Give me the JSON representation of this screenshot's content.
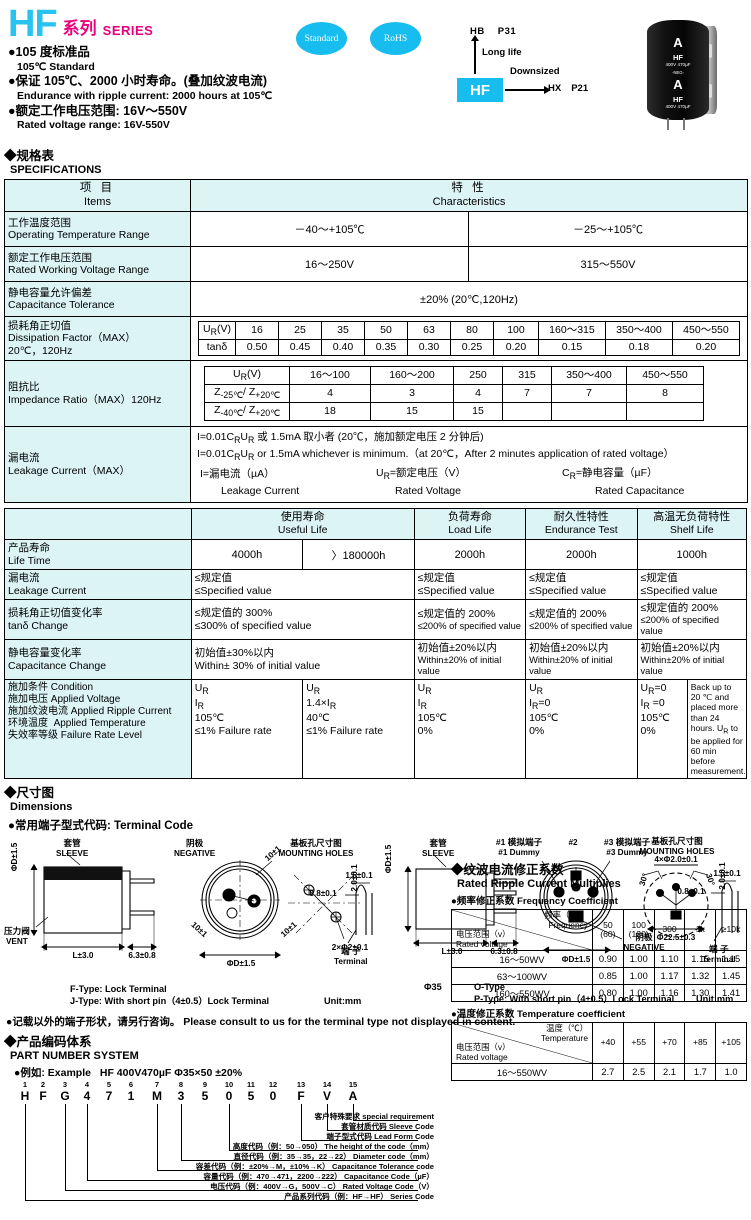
{
  "header": {
    "series_code": "HF",
    "series_cn": "系列",
    "series_en": "SERIES",
    "bullets": [
      {
        "cn": "●105 度标准品",
        "en": "105℃ Standard"
      },
      {
        "cn": "●保证 105℃、2000 小时寿命。(叠加纹波电流)",
        "en": "Endurance with ripple current: 2000 hours at 105℃"
      },
      {
        "cn": "●额定工作电压范围: 16V～550V",
        "en": "Rated voltage range: 16V-550V"
      }
    ],
    "badges": [
      "Standard",
      "RoHS"
    ],
    "roadmap": {
      "top_code": "HB",
      "top_page": "P31",
      "up_label": "Long life",
      "down_label": "Downsized",
      "center": "HF",
      "right_code": "HX",
      "right_page": "P21"
    },
    "photo": {
      "logo": "A",
      "name": "HF",
      "rating": "400V 470µF",
      "polarity": "-NEG-"
    }
  },
  "spec_section": {
    "title_cn": "◆规格表",
    "title_en": "SPECIFICATIONS",
    "head_item_cn": "项 目",
    "head_item_en": "Items",
    "head_char_cn": "特 性",
    "head_char_en": "Characteristics",
    "rows": {
      "temp": {
        "cn": "工作温度范围",
        "en": "Operating Temperature Range",
        "v1": "－40～+105℃",
        "v2": "－25～+105℃"
      },
      "voltage": {
        "cn": "额定工作电压范围",
        "en": "Rated Working Voltage Range",
        "v1": "16～250V",
        "v2": "315～550V"
      },
      "tolerance": {
        "cn": "静电容量允许偏差",
        "en": "Capacitance Tolerance",
        "value": "±20%   (20℃,120Hz)"
      },
      "dissipation": {
        "cn": "损耗角正切值",
        "en": "Dissipation Factor（MAX）",
        "cond": "20℃，120Hz",
        "row1_key": "UR(V)",
        "row2_key": "tanδ",
        "ur": [
          "16",
          "25",
          "35",
          "50",
          "63",
          "80",
          "100",
          "160～315",
          "350～400",
          "450～550"
        ],
        "tand": [
          "0.50",
          "0.45",
          "0.40",
          "0.35",
          "0.30",
          "0.25",
          "0.20",
          "0.15",
          "0.18",
          "0.20"
        ]
      },
      "impedance": {
        "cn": "阻抗比",
        "en": "Impedance Ratio（MAX）120Hz",
        "row1_key": "UR(V)",
        "row2_key": "Z-25℃/ Z+20℃",
        "row3_key": "Z-40℃/ Z+20℃",
        "ur": [
          "16～100",
          "160～200",
          "250",
          "315",
          "350～400",
          "450～550"
        ],
        "z25": [
          "4",
          "3",
          "4",
          "7",
          "7",
          "8"
        ],
        "z40": [
          "18",
          "15",
          "15",
          "",
          "",
          ""
        ]
      },
      "leakage": {
        "cn": "漏电流",
        "en": "Leakage Current（MAX）",
        "line1": "I=0.01CRUR 或 1.5mA 取小者  (20℃，施加额定电压 2 分钟后)",
        "line2": "I=0.01CRUR or 1.5mA whichever is minimum.（at 20℃，After 2 minutes application of rated voltage）",
        "line3_a": "I=漏电流（µA）",
        "line3_b": "UR=额定电压（V）",
        "line3_c": "CR=静电容量（µF）",
        "line4_a": "Leakage Current",
        "line4_b": "Rated Voltage",
        "line4_c": "Rated Capacitance"
      }
    }
  },
  "life_table": {
    "columns": [
      {
        "cn": "使用寿命",
        "en": "Useful Life"
      },
      {
        "cn": "负荷寿命",
        "en": "Load Life"
      },
      {
        "cn": "耐久性特性",
        "en": "Endurance Test"
      },
      {
        "cn": "高温无负荷特性",
        "en": "Shelf Life"
      }
    ],
    "life_time": {
      "cn": "产品寿命",
      "en": "Life Time",
      "values": [
        "4000h",
        "〉180000h",
        "2000h",
        "2000h",
        "1000h"
      ]
    },
    "leakage": {
      "cn": "漏电流",
      "en": "Leakage Current",
      "values": [
        {
          "cn": "≤规定值",
          "en": "≤Specified value"
        },
        {
          "cn": "≤规定值",
          "en": "≤Specified value"
        },
        {
          "cn": "≤规定值",
          "en": "≤Specified value"
        },
        {
          "cn": "≤规定值",
          "en": "≤Specified value"
        }
      ]
    },
    "tand": {
      "cn": "损耗角正切值变化率",
      "en": "tanδ Change",
      "values": [
        {
          "cn": "≤规定值的 300%",
          "en": "≤300% of specified value"
        },
        {
          "cn": "≤规定值的 200%",
          "en": "≤200% of specified value"
        },
        {
          "cn": "≤规定值的 200%",
          "en": "≤200% of specified value"
        },
        {
          "cn": "≤规定值的 200%",
          "en": "≤200% of specified value"
        }
      ]
    },
    "capchange": {
      "cn": "静电容量变化率",
      "en": "Capacitance Change",
      "values": [
        {
          "cn": "初始值±30%以内",
          "en": "Within± 30% of initial value"
        },
        {
          "cn": "初始值±20%以内",
          "en": "Within±20% of initial value"
        },
        {
          "cn": "初始值±20%以内",
          "en": "Within±20% of initial value"
        },
        {
          "cn": "初始值±20%以内",
          "en": "Within±20% of initial value"
        }
      ]
    },
    "condition": {
      "labels": [
        {
          "cn": "施加条件",
          "en": "Condition"
        },
        {
          "cn": "施加电压",
          "en": "Applied Voltage"
        },
        {
          "cn": "施加纹波电流",
          "en": "Applied Ripple Current"
        },
        {
          "cn": "环境温度",
          "en": "Applied Temperature"
        },
        {
          "cn": "失效率等级",
          "en": "Failure Rate Level"
        }
      ],
      "cols": [
        [
          "UR",
          "IR",
          "105℃",
          "≤1% Failure rate"
        ],
        [
          "UR",
          "1.4×IR",
          "40℃",
          "≤1% Failure rate"
        ],
        [
          "UR",
          "IR",
          "105℃",
          "0%"
        ],
        [
          "UR",
          "IR=0",
          "105℃",
          "0%"
        ],
        [
          "UR=0",
          "IR =0",
          "105℃",
          "0%"
        ]
      ],
      "backup": "Back up to 20 ℃ and placed more than 24 hours. UR to be applied for 60 min before measurement."
    }
  },
  "dimensions": {
    "title_cn": "◆尺寸图",
    "title_en": "Dimensions",
    "sub_cn": "●常用端子型式代码:",
    "sub_en": "Terminal Code",
    "left": {
      "sleeve_cn": "套管",
      "sleeve_en": "SLEEVE",
      "negative_cn": "阴极",
      "negative_en": "NEGATIVE",
      "mount_cn": "基板孔尺寸图",
      "mount_en": "MOUNTING HOLES",
      "vent_cn": "压力阀",
      "vent_en": "VENT",
      "d_label": "ΦD±1.5",
      "l_label": "L±3.0",
      "pin_label": "6.3±0.8",
      "d2_label": "ΦD±1.5",
      "pitch": "10±1",
      "pitch2": "10±1",
      "hole": "2×Φ2±0.1",
      "w15": "1.5±0.1",
      "w08": "0.8±0.1",
      "h20": "2.0±0.1",
      "terminal_cn": "端 子",
      "terminal_en": "Terminal",
      "note1": "F-Type:  Lock Terminal",
      "note2": "J-Type:  With short pin（4±0.5）Lock Terminal",
      "unit": "Unit:mm"
    },
    "right": {
      "sleeve_cn": "套管",
      "sleeve_en": "SLEEVE",
      "d1_cn": "#1 模拟端子",
      "d1_en": "#1 Dummy",
      "d2_top": "#2",
      "d3_cn": "#3 模拟端子",
      "d3_en": "#3 Dummy",
      "negative_cn": "阴极",
      "negative_en": "NEGATIVE",
      "mount_cn": "基板孔尺寸图",
      "mount_en": "MOUNTING HOLES",
      "d_label": "ΦD±1.5",
      "l_label": "L±3.0",
      "pin_label": "6.3±0.8",
      "d2_label": "ΦD±1.5",
      "holes": "4×Φ2.0±0.1",
      "circle": "Φ22.5±0.3",
      "ang1": "30°",
      "ang2": "30°",
      "w15": "1.5±0.1",
      "w08": "0.8±0.1",
      "h20": "2.0±0.1",
      "terminal_cn": "端 子",
      "terminal_en": "Terminal",
      "size": "Φ35",
      "note1": "O-Type",
      "note2": "P-Type:  With short pin（4±0.5）Lock Terminal",
      "unit": "Unit:mm"
    }
  },
  "part_number": {
    "consult_cn": "●记载以外的端子形状，请另行咨询。",
    "consult_en": "Please consult to us for the terminal type not displayed in content.",
    "title_cn": "◆产品编码体系",
    "title_en": "PART NUMBER SYSTEM",
    "example_cn": "●例如:",
    "example_en": "Example",
    "example_value": "HF 400V470µF Φ35×50 ±20%",
    "indices": [
      "1",
      "2",
      "3",
      "4",
      "5",
      "6",
      "7",
      "8",
      "9",
      "10",
      "11",
      "12",
      "13",
      "14",
      "15"
    ],
    "chars": [
      "H",
      "F",
      "G",
      "4",
      "7",
      "1",
      "M",
      "3",
      "5",
      "0",
      "5",
      "0",
      "F",
      "V",
      "A"
    ],
    "legend": [
      {
        "cn": "客户特殊要求",
        "en": "special requirement"
      },
      {
        "cn": "套管材质代码",
        "en": "Sleeve Code"
      },
      {
        "cn": "端子型式代码",
        "en": "Lead Form Code"
      },
      {
        "cn": "高度代码（例：50→050）",
        "en": "The height of the code（mm）"
      },
      {
        "cn": "直径代码（例：35→35，22→22）",
        "en": "Diameter code（mm）"
      },
      {
        "cn": "容差代码（例：±20%→M，±10%→K）",
        "en": "Capacitance Tolerance code"
      },
      {
        "cn": "容量代码（例：470→471，2200→222）",
        "en": "Capacitance Code（µF）"
      },
      {
        "cn": "电压代码（例：400V→G，500V→C）",
        "en": "Rated Voltage Code（V）"
      },
      {
        "cn": "产品系列代码（例：HF→HF）",
        "en": "Series Code"
      }
    ]
  },
  "ripple": {
    "title_cn": "◆纹波电流修正系数",
    "title_en": "Rated Ripple Current Multiplies",
    "freq": {
      "sub_cn": "●频率修正系数",
      "sub_en": "Frequency Coefficient",
      "axis_top_cn": "频率（Hz）",
      "axis_top_en": "Frequency",
      "axis_left_cn": "电压范围（v）",
      "axis_left_en": "Rated voltage",
      "cols": [
        "50\n(60)",
        "100\n(120)",
        "300",
        "1k",
        "≥10k"
      ],
      "rows": [
        {
          "label": "16～50WV",
          "values": [
            "0.90",
            "1.00",
            "1.10",
            "1.15",
            "1.15"
          ]
        },
        {
          "label": "63～100WV",
          "values": [
            "0.85",
            "1.00",
            "1.17",
            "1.32",
            "1.45"
          ]
        },
        {
          "label": "160～550WV",
          "values": [
            "0.80",
            "1.00",
            "1.16",
            "1.30",
            "1.41"
          ]
        }
      ]
    },
    "temp": {
      "sub_cn": "●温度修正系数",
      "sub_en": "Temperature coefficient",
      "axis_top_cn": "温度（℃）",
      "axis_top_en": "Temperature",
      "axis_left_cn": "电压范围（v）",
      "axis_left_en": "Rated voltage",
      "cols": [
        "+40",
        "+55",
        "+70",
        "+85",
        "+105"
      ],
      "rows": [
        {
          "label": "16～550WV",
          "values": [
            "2.7",
            "2.5",
            "2.1",
            "1.7",
            "1.0"
          ]
        }
      ]
    }
  },
  "colors": {
    "brand_cyan": "#29C3F0",
    "brand_magenta": "#E8007D",
    "badge_cyan": "#18BDF0",
    "table_label_bg": "#DCF4F4"
  }
}
